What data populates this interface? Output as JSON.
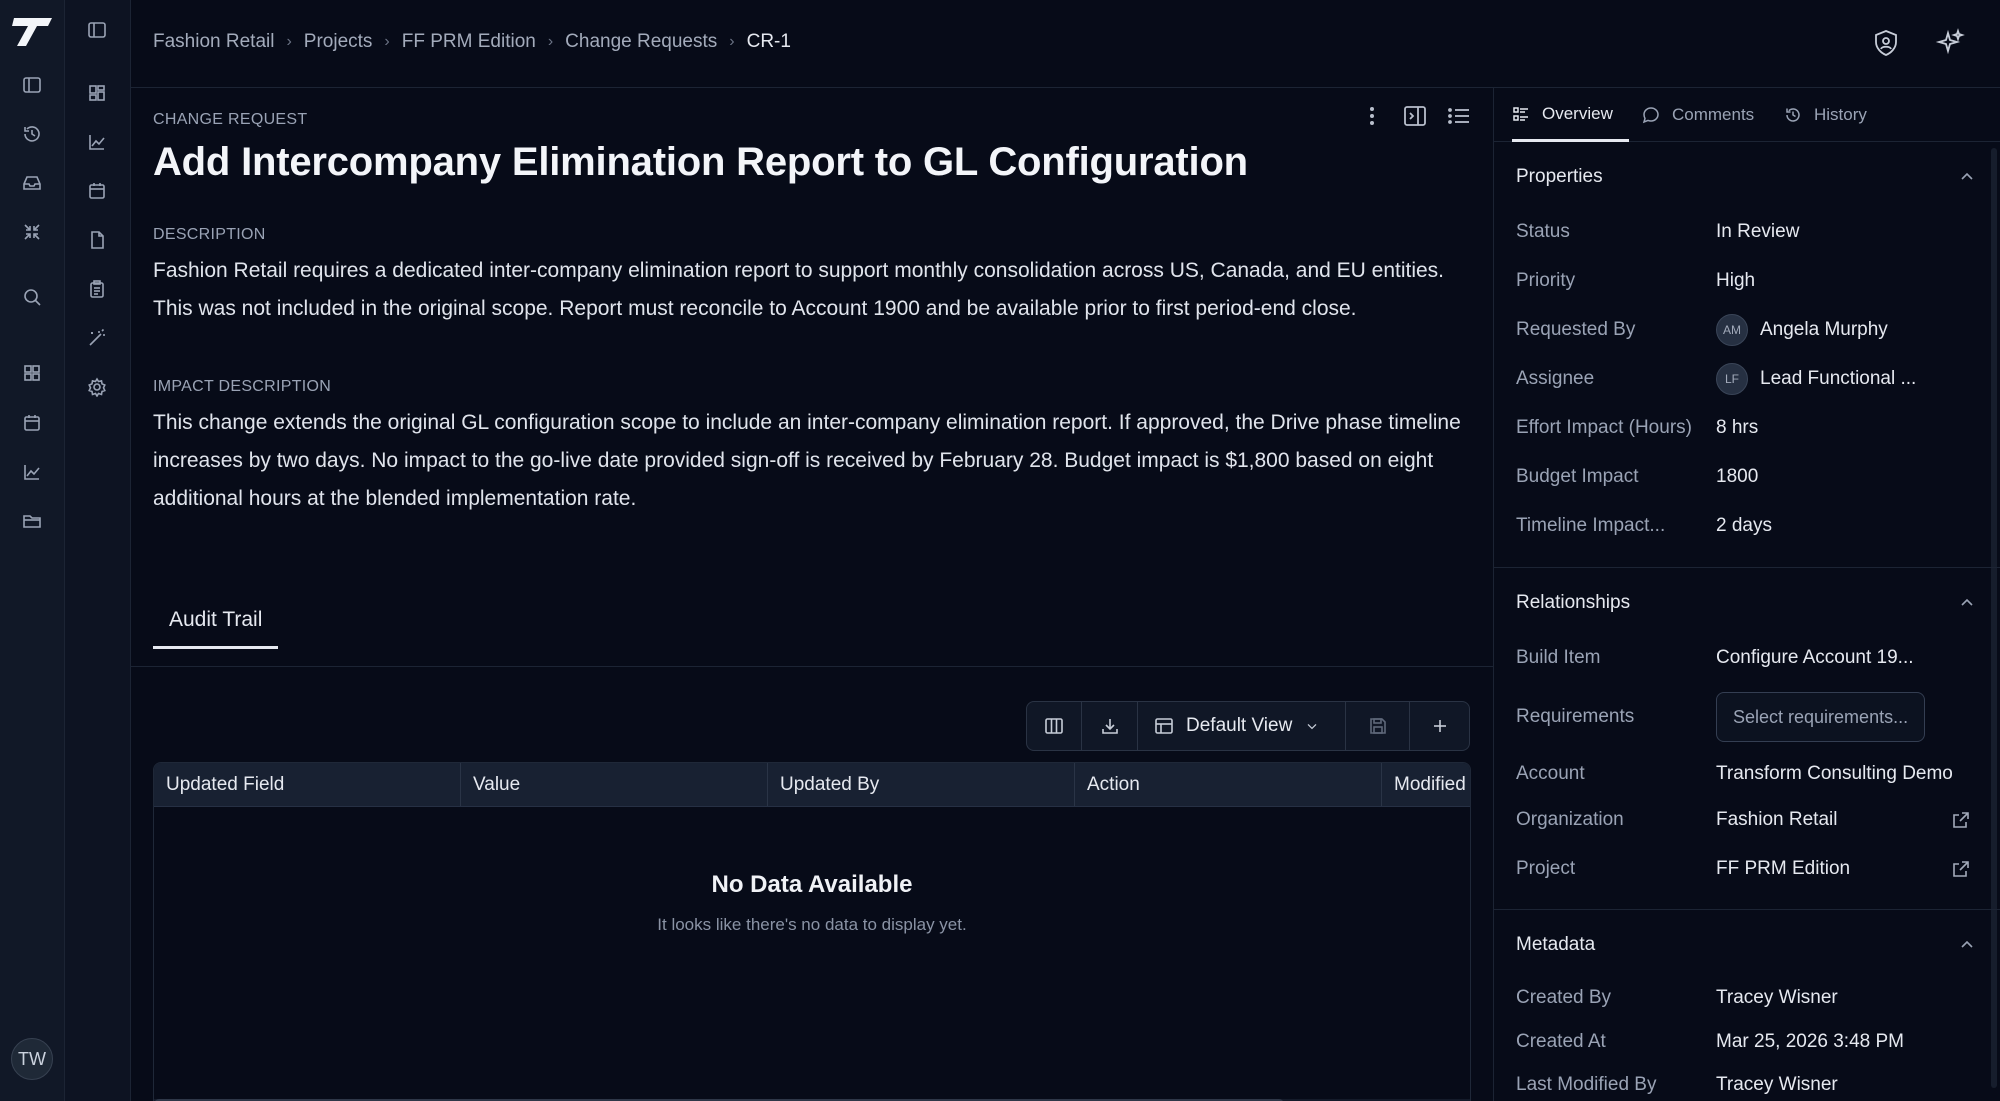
{
  "user": {
    "initials": "TW"
  },
  "breadcrumb": [
    "Fashion Retail",
    "Projects",
    "FF PRM Edition",
    "Change Requests",
    "CR-1"
  ],
  "record": {
    "type_label": "CHANGE REQUEST",
    "title": "Add Intercompany Elimination Report to GL Configuration",
    "description_label": "DESCRIPTION",
    "description": "Fashion Retail requires a dedicated inter-company elimination report to support monthly consolidation across US, Canada, and EU entities. This was not included in the original scope. Report must reconcile to Account 1900 and be available prior to first period-end close.",
    "impact_label": "IMPACT DESCRIPTION",
    "impact": "This change extends the original GL configuration scope to include an inter-company elimination report. If approved, the Drive phase timeline increases by two days. No impact to the go-live date provided sign-off is received by February 28. Budget impact is $1,800 based on eight additional hours at the blended implementation rate."
  },
  "audit": {
    "tab_label": "Audit Trail",
    "view_label": "Default View",
    "columns": [
      "Updated Field",
      "Value",
      "Updated By",
      "Action",
      "Modified"
    ],
    "empty_title": "No Data Available",
    "empty_subtitle": "It looks like there's no data to display yet."
  },
  "side_tabs": [
    "Overview",
    "Comments",
    "History"
  ],
  "properties": {
    "title": "Properties",
    "status_label": "Status",
    "status": "In Review",
    "priority_label": "Priority",
    "priority": "High",
    "requested_by_label": "Requested By",
    "requested_by_initials": "AM",
    "requested_by": "Angela Murphy",
    "assignee_label": "Assignee",
    "assignee_initials": "LF",
    "assignee": "Lead Functional ...",
    "effort_label": "Effort Impact (Hours)",
    "effort": "8 hrs",
    "budget_label": "Budget Impact",
    "budget": "1800",
    "timeline_label": "Timeline Impact...",
    "timeline": "2 days"
  },
  "relationships": {
    "title": "Relationships",
    "build_item_label": "Build Item",
    "build_item": "Configure Account 19...",
    "requirements_label": "Requirements",
    "requirements_placeholder": "Select requirements...",
    "account_label": "Account",
    "account": "Transform Consulting Demo",
    "organization_label": "Organization",
    "organization": "Fashion Retail",
    "project_label": "Project",
    "project": "FF PRM Edition"
  },
  "metadata": {
    "title": "Metadata",
    "created_by_label": "Created By",
    "created_by": "Tracey Wisner",
    "created_at_label": "Created At",
    "created_at": "Mar 25, 2026 3:48 PM",
    "modified_by_label": "Last Modified By",
    "modified_by": "Tracey Wisner"
  }
}
